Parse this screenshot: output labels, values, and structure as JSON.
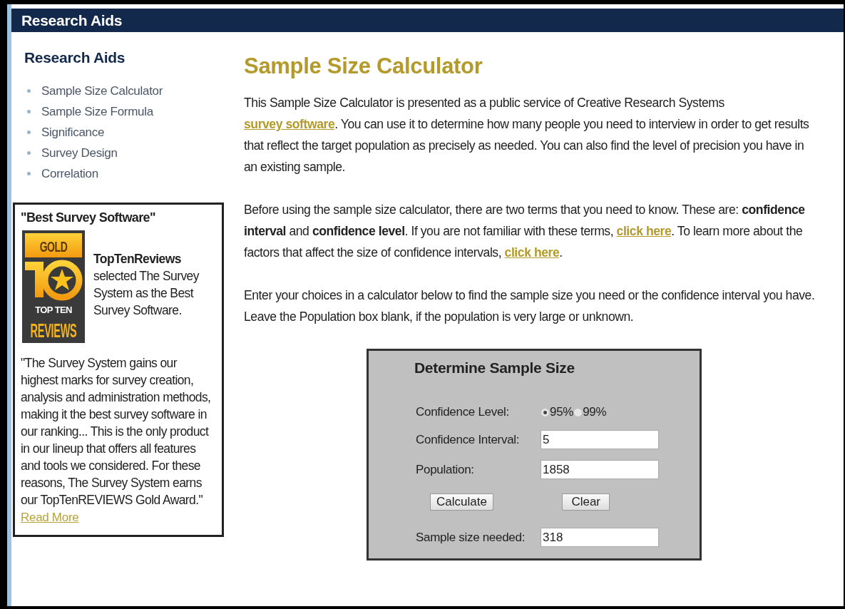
{
  "header": {
    "title": "Research Aids"
  },
  "sidebar": {
    "title": "Research Aids",
    "items": [
      {
        "label": "Sample Size Calculator"
      },
      {
        "label": "Sample Size Formula"
      },
      {
        "label": "Significance"
      },
      {
        "label": "Survey Design"
      },
      {
        "label": "Correlation"
      }
    ],
    "review": {
      "title": "\"Best Survey Software\"",
      "badge": {
        "top": "GOLD",
        "middle": "TOP TEN",
        "bottom": "REVIEWS"
      },
      "source": "TopTenReviews",
      "summary": "selected The Survey System as the Best Survey Software.",
      "quote": "\"The Survey System gains our highest marks for survey creation, analysis and administration methods, making it the best survey software in our ranking... This is the only product in our lineup that offers all features and tools we considered. For these reasons, The Survey System earns our TopTenREVIEWS Gold Award.\"",
      "link": "Read More"
    }
  },
  "main": {
    "title": "Sample Size Calculator",
    "paragraphs": [
      [
        {
          "kind": "text",
          "text": "This Sample Size Calculator is presented as a public service of Creative Research Systems "
        },
        {
          "kind": "link",
          "text": "survey software"
        },
        {
          "kind": "text",
          "text": ". You can use it to determine how many people you need to interview in order to get results that reflect the target population as precisely as needed. You can also find the level of precision you have in an existing sample."
        }
      ],
      [
        {
          "kind": "text",
          "text": "Before using the sample size calculator, there are two terms that you need to know. These are: **confidence interval** and **confidence level**. If you are not familiar with these terms, "
        },
        {
          "kind": "link",
          "text": "click here"
        },
        {
          "kind": "text",
          "text": ". To learn more about the factors that affect the size of confidence intervals, "
        },
        {
          "kind": "link",
          "text": "click here"
        },
        {
          "kind": "text",
          "text": "."
        }
      ],
      [
        {
          "kind": "text",
          "text": "Enter your choices in a calculator below to find the sample size you need or the confidence interval you have. Leave the Population box blank, if the population is very large or unknown."
        }
      ]
    ]
  },
  "calculator": {
    "title": "Determine Sample Size",
    "confidence_label": "Confidence Level:",
    "confidence_options": [
      {
        "label": "95%",
        "selected": true
      },
      {
        "label": "99%",
        "selected": false
      }
    ],
    "fields": [
      {
        "label": "Confidence Interval:",
        "value": "5"
      },
      {
        "label": "Population:",
        "value": "1858"
      }
    ],
    "buttons": [
      "Calculate",
      "Clear"
    ],
    "result": {
      "label": "Sample size needed:",
      "value": "318"
    }
  }
}
